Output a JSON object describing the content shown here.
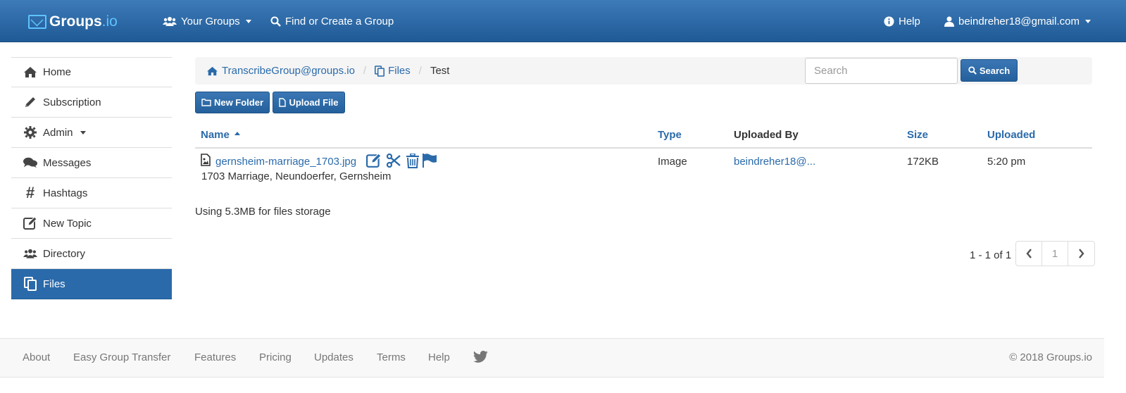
{
  "navbar": {
    "logo_main": "Groups",
    "logo_suffix": ".io",
    "your_groups": "Your Groups",
    "find_create": "Find or Create a Group",
    "help": "Help",
    "user_email": "beindreher18@gmail.com"
  },
  "sidebar": {
    "items": [
      {
        "label": "Home",
        "icon": "home-icon"
      },
      {
        "label": "Subscription",
        "icon": "pencil-icon"
      },
      {
        "label": "Admin",
        "icon": "gear-icon"
      },
      {
        "label": "Messages",
        "icon": "comments-icon"
      },
      {
        "label": "Hashtags",
        "icon": "hashtag-icon"
      },
      {
        "label": "New Topic",
        "icon": "edit-icon"
      },
      {
        "label": "Directory",
        "icon": "users-icon"
      },
      {
        "label": "Files",
        "icon": "files-icon"
      }
    ],
    "active": "Files"
  },
  "breadcrumb": {
    "group": "TranscribeGroup@groups.io",
    "files": "Files",
    "current": "Test"
  },
  "search": {
    "placeholder": "Search",
    "button_label": "Search"
  },
  "toolbar": {
    "new_folder": "New Folder",
    "upload_file": "Upload File"
  },
  "table": {
    "columns": {
      "name": "Name",
      "type": "Type",
      "uploaded_by": "Uploaded By",
      "size": "Size",
      "uploaded": "Uploaded"
    },
    "rows": [
      {
        "name": "gernsheim-marriage_1703.jpg",
        "description": "1703 Marriage, Neundoerfer, Gernsheim",
        "type": "Image",
        "uploaded_by": "beindreher18@...",
        "size": "172KB",
        "uploaded": "5:20 pm"
      }
    ]
  },
  "storage_text": "Using 5.3MB for files storage",
  "pagination": {
    "summary": "1 - 1 of 1",
    "page": "1"
  },
  "footer": {
    "links": [
      "About",
      "Easy Group Transfer",
      "Features",
      "Pricing",
      "Updates",
      "Terms",
      "Help"
    ],
    "copyright": "© 2018 Groups.io"
  },
  "colors": {
    "navbar": "#2a6aaa",
    "link": "#2a6aaa",
    "active_sidebar": "#2a6aaa"
  }
}
